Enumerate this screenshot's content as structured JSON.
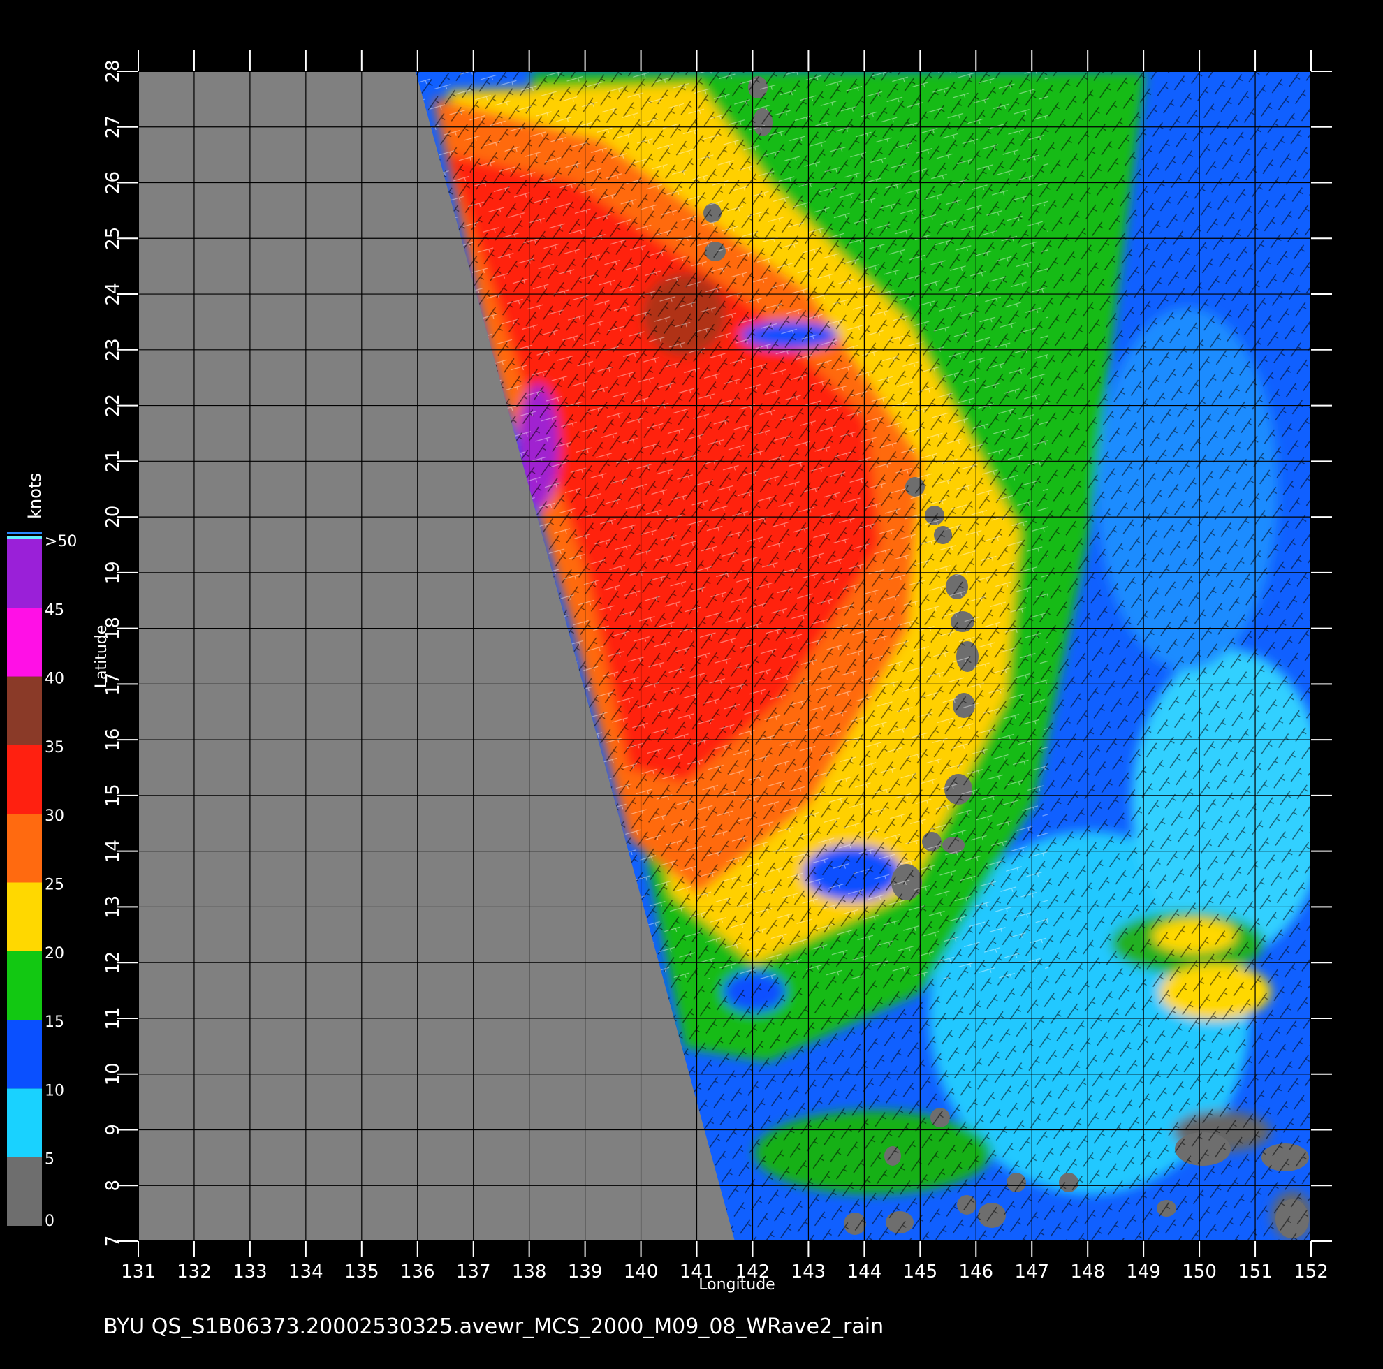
{
  "map": {
    "caption": "BYU  QS_S1B06373.20002530325.avewr_MCS_2000_M09_08_WRave2_rain",
    "xlabel": "Longitude",
    "ylabel": "Latitude",
    "lon_range": [
      131,
      152
    ],
    "lat_range": [
      7,
      28
    ],
    "lon_ticks": [
      "131",
      "132",
      "133",
      "134",
      "135",
      "136",
      "137",
      "138",
      "139",
      "140",
      "141",
      "142",
      "143",
      "144",
      "145",
      "146",
      "147",
      "148",
      "149",
      "150",
      "151",
      "152"
    ],
    "lat_ticks": [
      "7",
      "8",
      "9",
      "10",
      "11",
      "12",
      "13",
      "14",
      "15",
      "16",
      "17",
      "18",
      "19",
      "20",
      "21",
      "22",
      "23",
      "24",
      "25",
      "26",
      "27",
      "28"
    ],
    "colors": {
      "background": "#000000",
      "no_data": "#808080",
      "grid": "#000000"
    }
  },
  "colorbar": {
    "title": "knots",
    "labels": [
      "0",
      "5",
      "10",
      "15",
      "20",
      "25",
      "30",
      "35",
      "40",
      "45",
      ">50"
    ],
    "bands": [
      {
        "from": 0,
        "to": 5,
        "color": "#6e6e6e"
      },
      {
        "from": 5,
        "to": 10,
        "color": "#19d2ff"
      },
      {
        "from": 10,
        "to": 15,
        "color": "#0a50ff"
      },
      {
        "from": 15,
        "to": 20,
        "color": "#12c812"
      },
      {
        "from": 20,
        "to": 25,
        "color": "#ffd800"
      },
      {
        "from": 25,
        "to": 30,
        "color": "#ff6a10"
      },
      {
        "from": 30,
        "to": 35,
        "color": "#ff2010"
      },
      {
        "from": 35,
        "to": 40,
        "color": "#8a3a28"
      },
      {
        "from": 40,
        "to": 45,
        "color": "#ff10e6"
      },
      {
        "from": 45,
        "to": 50,
        "color": "#9a20d8"
      }
    ]
  }
}
